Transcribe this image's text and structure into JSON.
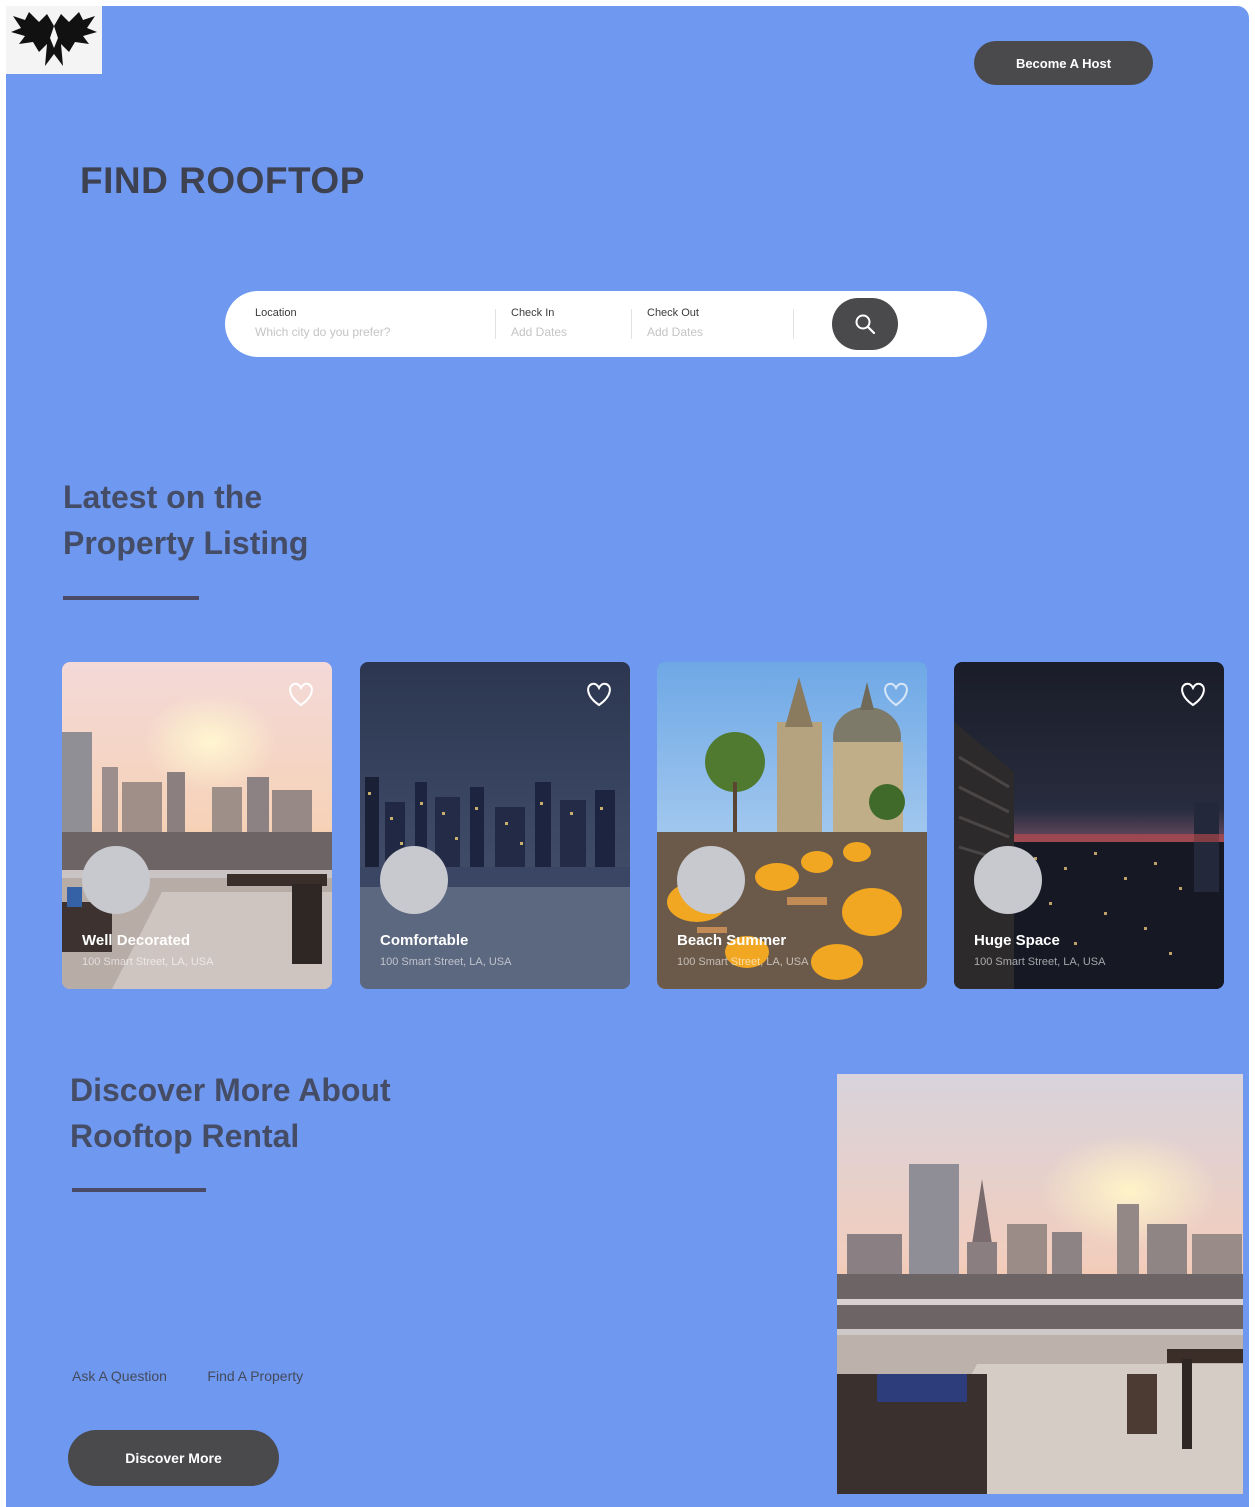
{
  "header": {
    "logo_icon": "winged-eagle-logo",
    "host_button_label": "Become A Host"
  },
  "hero": {
    "title": "FIND ROOFTOP"
  },
  "search": {
    "location_label": "Location",
    "location_placeholder": "Which city do you prefer?",
    "checkin_label": "Check In",
    "checkin_placeholder": "Add Dates",
    "checkout_label": "Check Out",
    "checkout_placeholder": "Add Dates",
    "button_icon": "search-icon"
  },
  "listing": {
    "title_line1": "Latest on the",
    "title_line2": "Property Listing",
    "cards": [
      {
        "title": "Well Decorated",
        "address": "100 Smart Street, LA, USA"
      },
      {
        "title": "Comfortable",
        "address": "100 Smart Street, LA, USA"
      },
      {
        "title": "Beach Summer",
        "address": "100 Smart Street, LA, USA"
      },
      {
        "title": "Huge Space",
        "address": "100 Smart Street, LA, USA"
      }
    ]
  },
  "discover": {
    "title_line1": "Discover More About",
    "title_line2": "Rooftop Rental",
    "link_ask": "Ask A Question",
    "link_find": "Find A Property",
    "button_label": "Discover More"
  },
  "colors": {
    "page_background": "#6f98f1",
    "dark_button": "#4a4a4d",
    "heading": "#3e4150"
  }
}
